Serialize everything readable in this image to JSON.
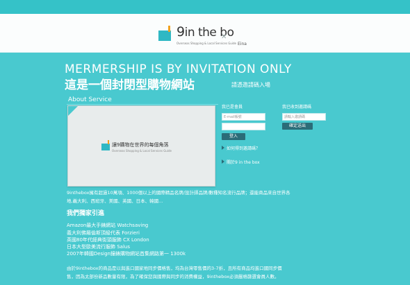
{
  "brand": {
    "name_nine": "9",
    "name_rest": "in the bo",
    "tagline": "Overseas Shopping & Local Services Guide",
    "lang_label": "Eina"
  },
  "hero": {
    "headline_en": "MERMERSHIP IS BY INVITATION ONLY",
    "headline_zh": "這是一個封閉型購物網站",
    "invite_link": "請憑邀請碼入場"
  },
  "about": {
    "title": "About Service",
    "video_title": "讓9購物在世界的每個角落",
    "video_sub": "Overseas Shopping & Local Services Guide"
  },
  "login": {
    "label": "我已是會員",
    "email_placeholder": "E-mail帳號",
    "password_placeholder": "",
    "submit": "登入"
  },
  "register": {
    "label": "我已收到邀請碼",
    "code_placeholder": "請輸入邀請碼",
    "submit": "確定送出"
  },
  "links": {
    "how_to_get_invite": "如何得到邀請碼？",
    "about_site": "關於9 in the box"
  },
  "intro": {
    "line1": "9inthebox擁有超過10萬項、1000個以上的國際精品名牌/設計師品牌/數種知名流行品牌；還能商品來自世界各",
    "line2": "地,義大利、西班牙、美國、英國、日本、韓國..."
  },
  "exclusive": {
    "title": "我們獨家引進",
    "items": [
      "Amazon最大手錶網站 Watchsaving",
      "義大利佛羅倫斯頂級代表 Forzieri",
      "英國80年代經典街頭服飾 CX London",
      "日本大型歐美流行服飾 Salus",
      "2007年韓國Design鐘錶購物網站首集網路第一 1300k"
    ]
  },
  "footer_text": {
    "line1": "由於9inthebox的商品是以與進口國家地同步價格售，均為台灣零售價的3-7折，且所有商品均進口國同步價",
    "line2": "售，因為太部份新品數量有限，為了確保您與國際與同步的消費權益，9inthebox必須嚴格篩選會員人數。"
  }
}
